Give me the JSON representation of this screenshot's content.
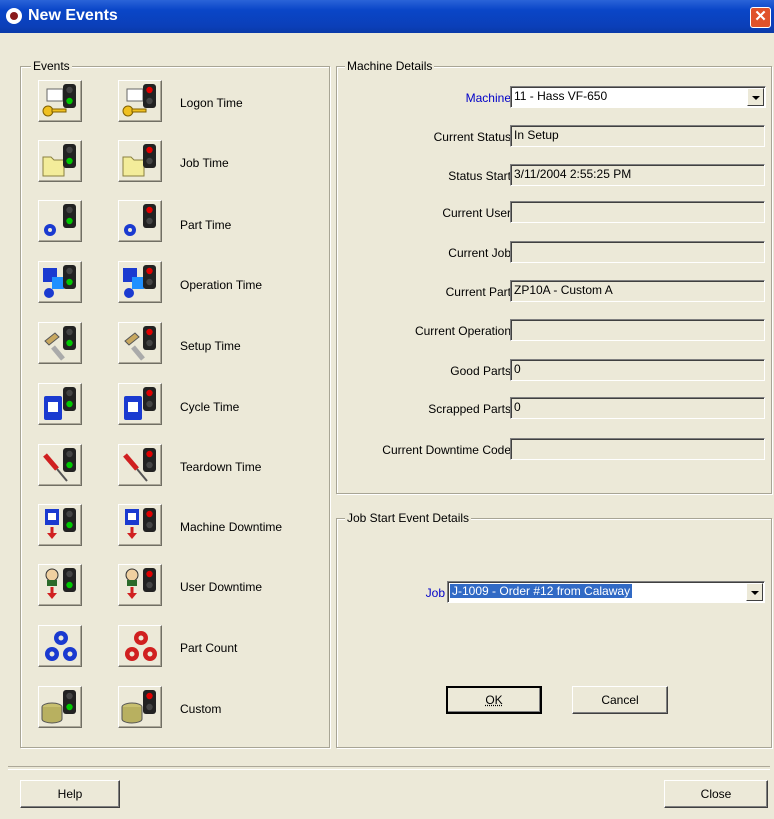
{
  "window": {
    "title": "New Events",
    "close_glyph": "✕"
  },
  "events_group": {
    "title": "Events",
    "items": [
      {
        "label": "Logon Time",
        "icon": "key-icon"
      },
      {
        "label": "Job Time",
        "icon": "folder-icon"
      },
      {
        "label": "Part Time",
        "icon": "gear-icon"
      },
      {
        "label": "Operation Time",
        "icon": "operation-icon"
      },
      {
        "label": "Setup Time",
        "icon": "wrench-icon"
      },
      {
        "label": "Cycle Time",
        "icon": "machine-icon"
      },
      {
        "label": "Teardown Time",
        "icon": "screwdriver-icon"
      },
      {
        "label": "Machine Downtime",
        "icon": "machine-down-icon"
      },
      {
        "label": "User Downtime",
        "icon": "user-down-icon"
      },
      {
        "label": "Part Count",
        "icon": "gears-icon"
      },
      {
        "label": "Custom",
        "icon": "database-icon"
      }
    ]
  },
  "machine_details": {
    "title": "Machine Details",
    "machine_label": "Machine",
    "machine_value": "11 - Hass VF-650",
    "rows": [
      {
        "label": "Current Status",
        "value": "In Setup"
      },
      {
        "label": "Status Start",
        "value": "3/11/2004 2:55:25 PM"
      },
      {
        "label": "Current User",
        "value": ""
      },
      {
        "label": "Current Job",
        "value": ""
      },
      {
        "label": "Current Part",
        "value": "ZP10A - Custom A"
      },
      {
        "label": "Current Operation",
        "value": ""
      },
      {
        "label": "Good Parts",
        "value": "0"
      },
      {
        "label": "Scrapped Parts",
        "value": "0"
      },
      {
        "label": "Current Downtime Code",
        "value": ""
      }
    ]
  },
  "job_start": {
    "title": "Job Start Event Details",
    "job_label": "Job",
    "job_value": "J-1009 - Order #12 from Calaway",
    "ok_label": "OK",
    "cancel_label": "Cancel"
  },
  "footer": {
    "help_label": "Help",
    "close_label": "Close"
  },
  "colors": {
    "title_bar": "#0a46c8",
    "label_accent": "#0000c8",
    "green_light": "#00c800",
    "red_light": "#e00000",
    "selection": "#316ac5"
  }
}
